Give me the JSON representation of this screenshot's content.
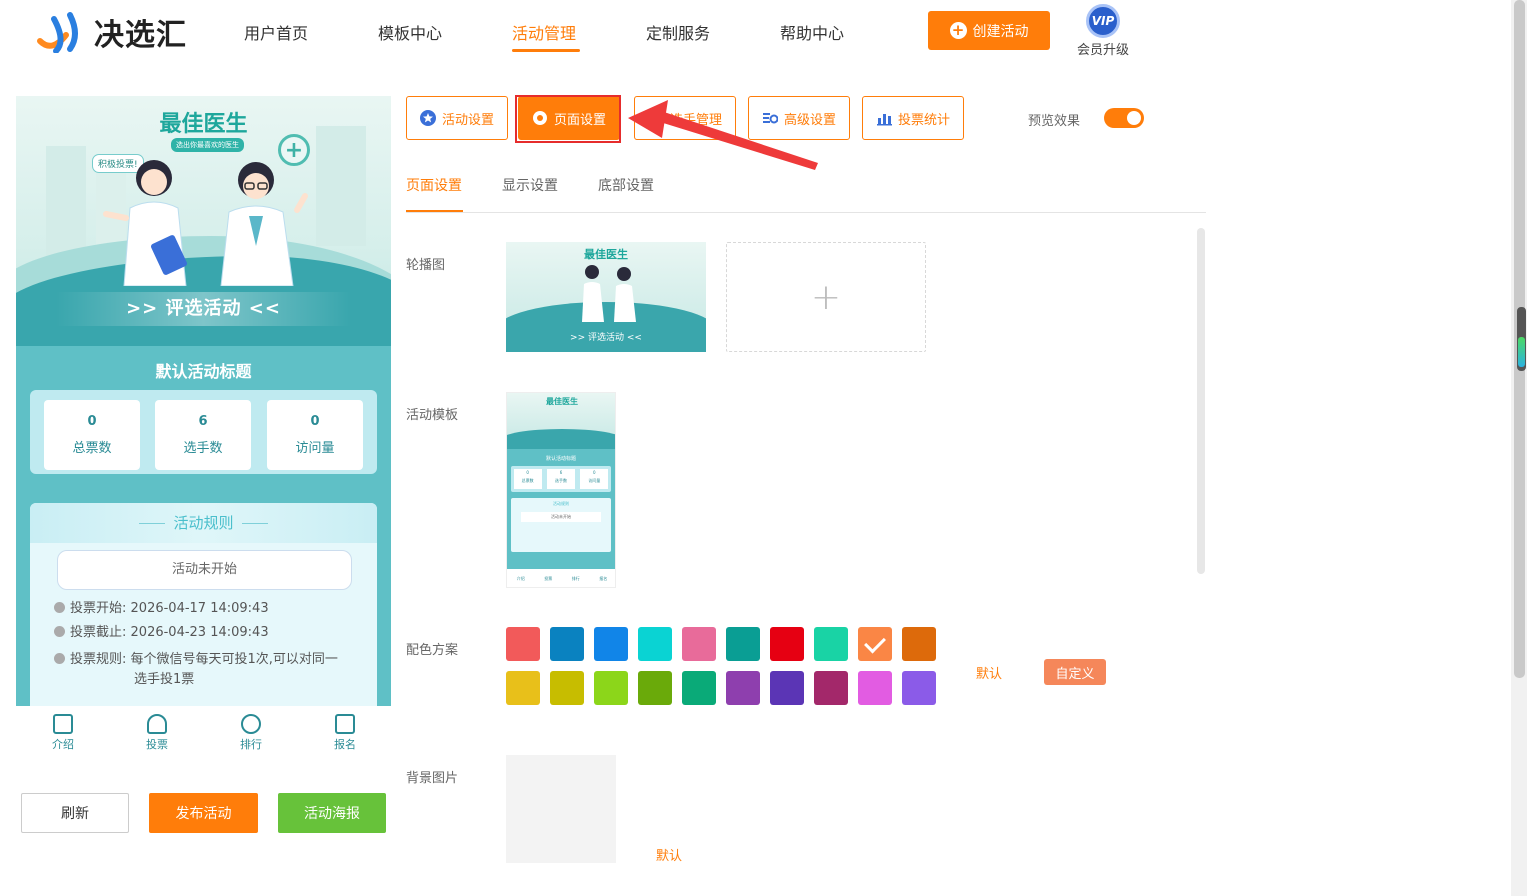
{
  "header": {
    "logo_text": "决选汇",
    "nav": [
      "用户首页",
      "模板中心",
      "活动管理",
      "定制服务",
      "帮助中心"
    ],
    "active_nav": "活动管理",
    "create_label": "创建活动",
    "vip_badge": "VIP",
    "vip_label": "会员升级"
  },
  "preview": {
    "banner_title": "最佳医生",
    "banner_sub": "选出你最喜欢的医生",
    "bubble": "积极投票!",
    "banner_strip": ">> 评选活动 <<",
    "activity_title": "默认活动标题",
    "stats": [
      {
        "value": "0",
        "label": "总票数"
      },
      {
        "value": "6",
        "label": "选手数"
      },
      {
        "value": "0",
        "label": "访问量"
      }
    ],
    "rules_title": "活动规则",
    "status": "活动未开始",
    "vote_start_label": "投票开始:",
    "vote_start": "2026-04-17 14:09:43",
    "vote_end_label": "投票截止:",
    "vote_end": "2026-04-23 14:09:43",
    "vote_rule_label": "投票规则:",
    "vote_rule_1": "每个微信号每天可投1次,可以对同一",
    "vote_rule_2": "选手投1票",
    "tabs": [
      "介绍",
      "投票",
      "排行",
      "报名"
    ]
  },
  "left_buttons": {
    "refresh": "刷新",
    "publish": "发布活动",
    "poster": "活动海报"
  },
  "toolbar": {
    "items": [
      "活动设置",
      "页面设置",
      "选手管理",
      "高级设置",
      "投票统计"
    ],
    "active": "页面设置",
    "preview_label": "预览效果",
    "preview_on": true
  },
  "subtabs": {
    "items": [
      "页面设置",
      "显示设置",
      "底部设置"
    ],
    "active": "页面设置"
  },
  "form": {
    "carousel_label": "轮播图",
    "add_symbol": "+",
    "template_label": "活动模板",
    "color_label": "配色方案",
    "colors_row1": [
      "#f25a5a",
      "#0a82c0",
      "#1185e8",
      "#0ad3d3",
      "#e86b9a",
      "#0a9e94",
      "#e60012",
      "#19d3a5",
      "#fa8645",
      "#dd6a0b"
    ],
    "colors_row2": [
      "#e8c01a",
      "#c7bd00",
      "#8cd61a",
      "#6aaa0a",
      "#0aaa78",
      "#8e3fae",
      "#5b35b5",
      "#a3286a",
      "#e25ce2",
      "#8b5be8"
    ],
    "selected_color": "#fa8645",
    "default_label": "默认",
    "custom_label": "自定义",
    "bg_label": "背景图片",
    "bg_default_label": "默认"
  },
  "mini": {
    "stats": [
      "0",
      "6",
      "0"
    ],
    "stat_labels": [
      "总票数",
      "选手数",
      "访问量"
    ],
    "title": "默认活动标题",
    "rules": "活动规则",
    "status": "活动未开始"
  }
}
